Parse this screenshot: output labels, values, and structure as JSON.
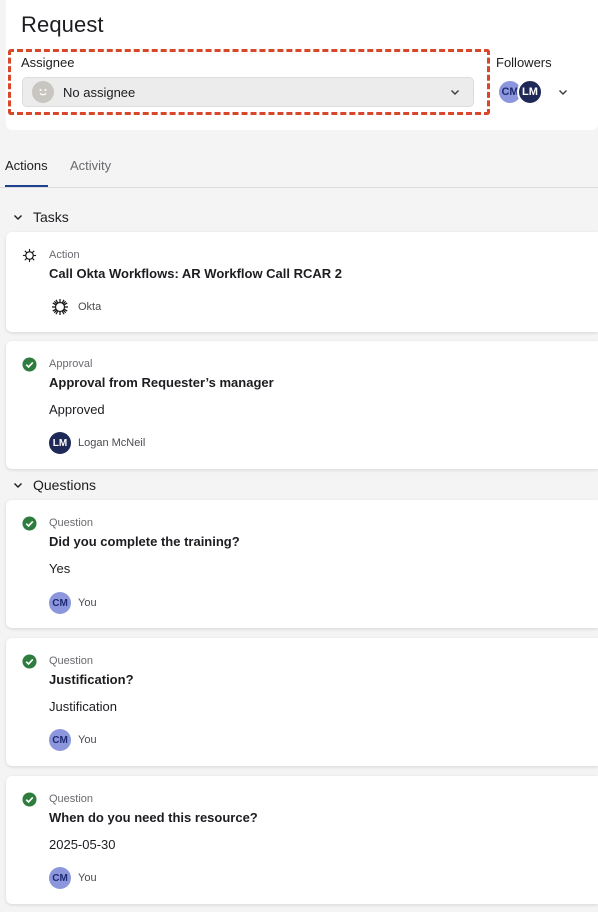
{
  "header": {
    "title": "Request",
    "assignee_label": "Assignee",
    "assignee_value": "No assignee",
    "followers_label": "Followers",
    "followers": [
      {
        "initials": "CM",
        "color": "#8b96dd"
      },
      {
        "initials": "LM",
        "color": "#1f2957"
      }
    ]
  },
  "tabs": [
    {
      "label": "Actions",
      "active": true
    },
    {
      "label": "Activity",
      "active": false
    }
  ],
  "tasks_section": {
    "label": "Tasks",
    "items": [
      {
        "icon": "gear-icon",
        "kind": "Action",
        "title": "Call Okta Workflows: AR Workflow Call RCAR 2",
        "foot_icon": "okta-icon",
        "foot_name": "Okta"
      },
      {
        "icon": "check-circle-icon",
        "kind": "Approval",
        "title": "Approval from Requester’s manager",
        "answer": "Approved",
        "foot_initials": "LM",
        "foot_name": "Logan McNeil"
      }
    ]
  },
  "questions_section": {
    "label": "Questions",
    "items": [
      {
        "kind": "Question",
        "title": "Did you complete the training?",
        "answer": "Yes",
        "foot_initials": "CM",
        "foot_name": "You"
      },
      {
        "kind": "Question",
        "title": "Justification?",
        "answer": "Justification",
        "foot_initials": "CM",
        "foot_name": "You"
      },
      {
        "kind": "Question",
        "title": "When do you need this resource?",
        "answer": "2025-05-30",
        "foot_initials": "CM",
        "foot_name": "You"
      }
    ]
  },
  "colors": {
    "accent": "#1f3f8f",
    "highlight": "#d9472b",
    "success": "#2e7d3e"
  }
}
